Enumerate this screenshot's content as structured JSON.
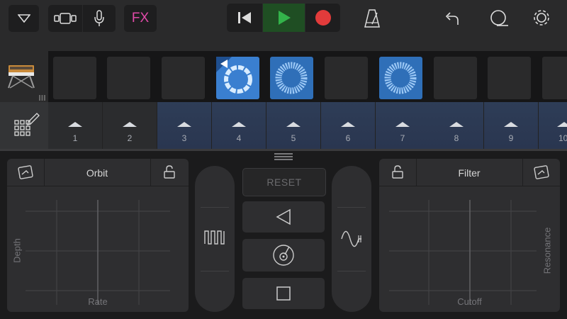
{
  "toolbar": {
    "fx_label": "FX",
    "colors": {
      "play_bg": "#1f4e23",
      "play_icon": "#33b34a",
      "record": "#e23b3b",
      "fx": "#e04aa8"
    }
  },
  "live_loops": {
    "cells": [
      {
        "state": "empty"
      },
      {
        "state": "empty"
      },
      {
        "state": "empty"
      },
      {
        "state": "playing"
      },
      {
        "state": "loaded"
      },
      {
        "state": "empty"
      },
      {
        "state": "loaded"
      },
      {
        "state": "empty"
      },
      {
        "state": "empty"
      },
      {
        "state": "empty"
      }
    ],
    "columns": [
      {
        "label": "1",
        "lit": false
      },
      {
        "label": "2",
        "lit": false
      },
      {
        "label": "3",
        "lit": true
      },
      {
        "label": "4",
        "lit": true
      },
      {
        "label": "5",
        "lit": true
      },
      {
        "label": "6",
        "lit": true
      },
      {
        "label": "7",
        "lit": true
      },
      {
        "label": "8",
        "lit": true
      },
      {
        "label": "9",
        "lit": true
      },
      {
        "label": "10",
        "lit": true
      }
    ]
  },
  "left_pad": {
    "title": "Orbit",
    "x_label": "Rate",
    "y_label": "Depth"
  },
  "right_pad": {
    "title": "Filter",
    "x_label": "Cutoff",
    "y_label": "Resonance"
  },
  "center": {
    "reset_label": "RESET"
  }
}
